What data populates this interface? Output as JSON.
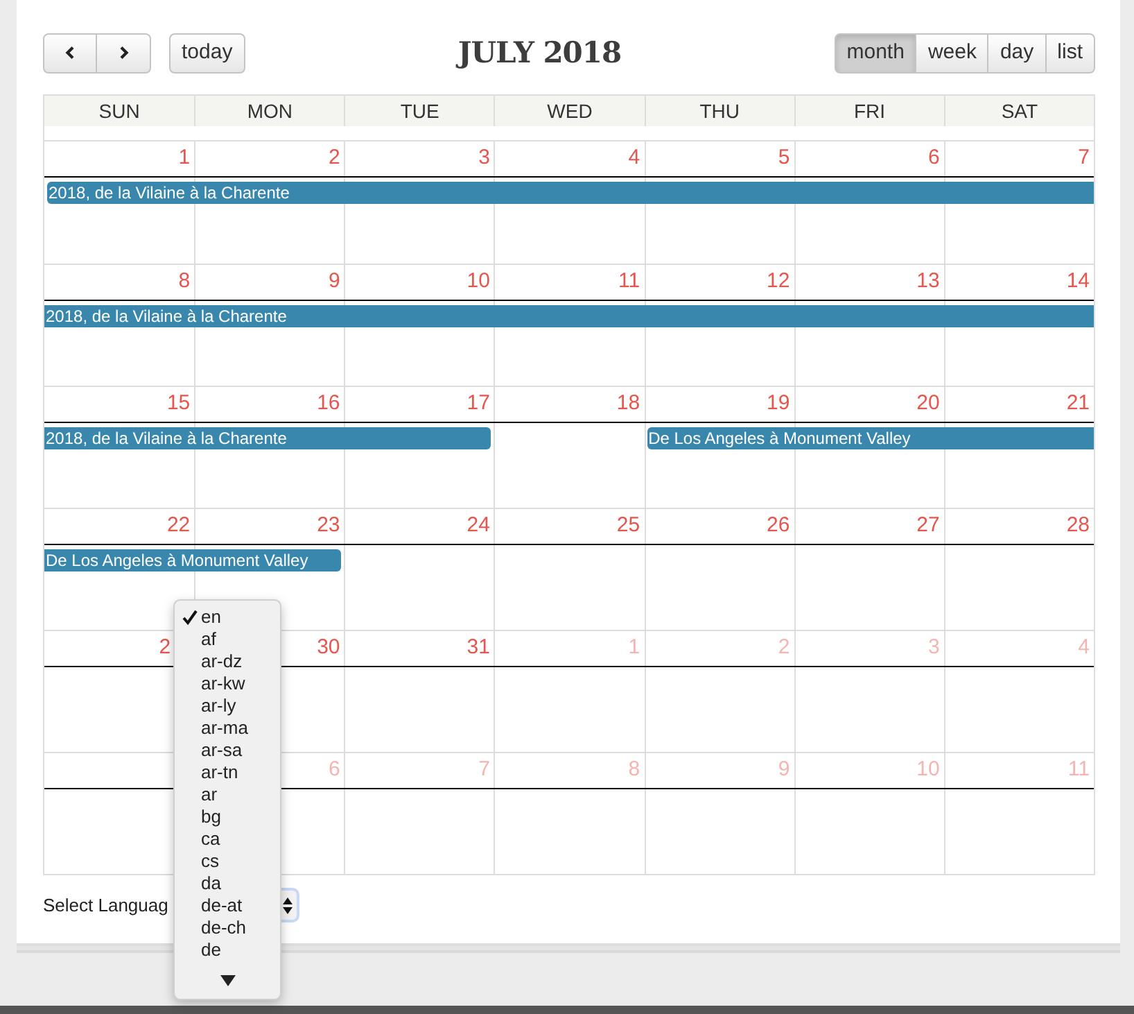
{
  "toolbar": {
    "nav_buttons": [
      {
        "kind": "prev"
      },
      {
        "kind": "next"
      }
    ],
    "today": "today",
    "title": "JULY 2018",
    "views": [
      {
        "label": "month",
        "selected": true
      },
      {
        "label": "week",
        "selected": false
      },
      {
        "label": "day",
        "selected": false
      },
      {
        "label": "list",
        "selected": false
      }
    ]
  },
  "weekdays": [
    "SUN",
    "MON",
    "TUE",
    "WED",
    "THU",
    "FRI",
    "SAT"
  ],
  "weeks": [
    {
      "days": [
        {
          "label": "1",
          "other_month": false,
          "event": {
            "title": "2018, de la Vilaine à la Charente",
            "continues_before": false
          }
        },
        {
          "label": "2",
          "other_month": false
        },
        {
          "label": "3",
          "other_month": false
        },
        {
          "label": "4",
          "other_month": false
        },
        {
          "label": "5",
          "other_month": false
        },
        {
          "label": "6",
          "other_month": false
        },
        {
          "label": "7",
          "other_month": false
        }
      ]
    },
    {
      "days": [
        {
          "label": "8",
          "other_month": false,
          "event": {
            "title": "2018, de la Vilaine à la Charente",
            "continues_before": true
          }
        },
        {
          "label": "9",
          "other_month": false
        },
        {
          "label": "10",
          "other_month": false
        },
        {
          "label": "11",
          "other_month": false
        },
        {
          "label": "12",
          "other_month": false
        },
        {
          "label": "13",
          "other_month": false
        },
        {
          "label": "14",
          "other_month": false
        }
      ]
    },
    {
      "days": [
        {
          "label": "15",
          "other_month": false,
          "event": {
            "title": "2018, de la Vilaine à la Charente",
            "continues_before": true
          }
        },
        {
          "label": "16",
          "other_month": false
        },
        {
          "label": "17",
          "other_month": false,
          "event_ends": true
        },
        {
          "label": "18",
          "other_month": false
        },
        {
          "label": "19",
          "other_month": false,
          "event": {
            "title": "De Los Angeles à Monument Valley",
            "continues_before": false
          }
        },
        {
          "label": "20",
          "other_month": false
        },
        {
          "label": "21",
          "other_month": false
        }
      ]
    },
    {
      "days": [
        {
          "label": "22",
          "other_month": false,
          "event": {
            "title": "De Los Angeles à Monument Valley",
            "continues_before": true
          }
        },
        {
          "label": "23",
          "other_month": false,
          "event_ends": true
        },
        {
          "label": "24",
          "other_month": false
        },
        {
          "label": "25",
          "other_month": false
        },
        {
          "label": "26",
          "other_month": false
        },
        {
          "label": "27",
          "other_month": false
        },
        {
          "label": "28",
          "other_month": false
        }
      ]
    },
    {
      "days": [
        {
          "label": "2",
          "other_month": false,
          "partly_hidden": true
        },
        {
          "label": "30",
          "other_month": false
        },
        {
          "label": "31",
          "other_month": false
        },
        {
          "label": "1",
          "other_month": true
        },
        {
          "label": "2",
          "other_month": true
        },
        {
          "label": "3",
          "other_month": true
        },
        {
          "label": "4",
          "other_month": true
        }
      ]
    },
    {
      "days": [
        {
          "label": "6",
          "other_month": true
        },
        {
          "label": "7",
          "other_month": true
        },
        {
          "label": "8",
          "other_month": true
        },
        {
          "label": "9",
          "other_month": true
        },
        {
          "label": "10",
          "other_month": true
        },
        {
          "label": "11",
          "other_month": true
        }
      ]
    }
  ],
  "language": {
    "label": "Select Languag",
    "options": [
      {
        "label": "en",
        "selected": true
      },
      {
        "label": "af",
        "selected": false
      },
      {
        "label": "ar-dz",
        "selected": false
      },
      {
        "label": "ar-kw",
        "selected": false
      },
      {
        "label": "ar-ly",
        "selected": false
      },
      {
        "label": "ar-ma",
        "selected": false
      },
      {
        "label": "ar-sa",
        "selected": false
      },
      {
        "label": "ar-tn",
        "selected": false
      },
      {
        "label": "ar",
        "selected": false
      },
      {
        "label": "bg",
        "selected": false
      },
      {
        "label": "ca",
        "selected": false
      },
      {
        "label": "cs",
        "selected": false
      },
      {
        "label": "da",
        "selected": false
      },
      {
        "label": "de-at",
        "selected": false
      },
      {
        "label": "de-ch",
        "selected": false
      },
      {
        "label": "de",
        "selected": false
      }
    ]
  }
}
